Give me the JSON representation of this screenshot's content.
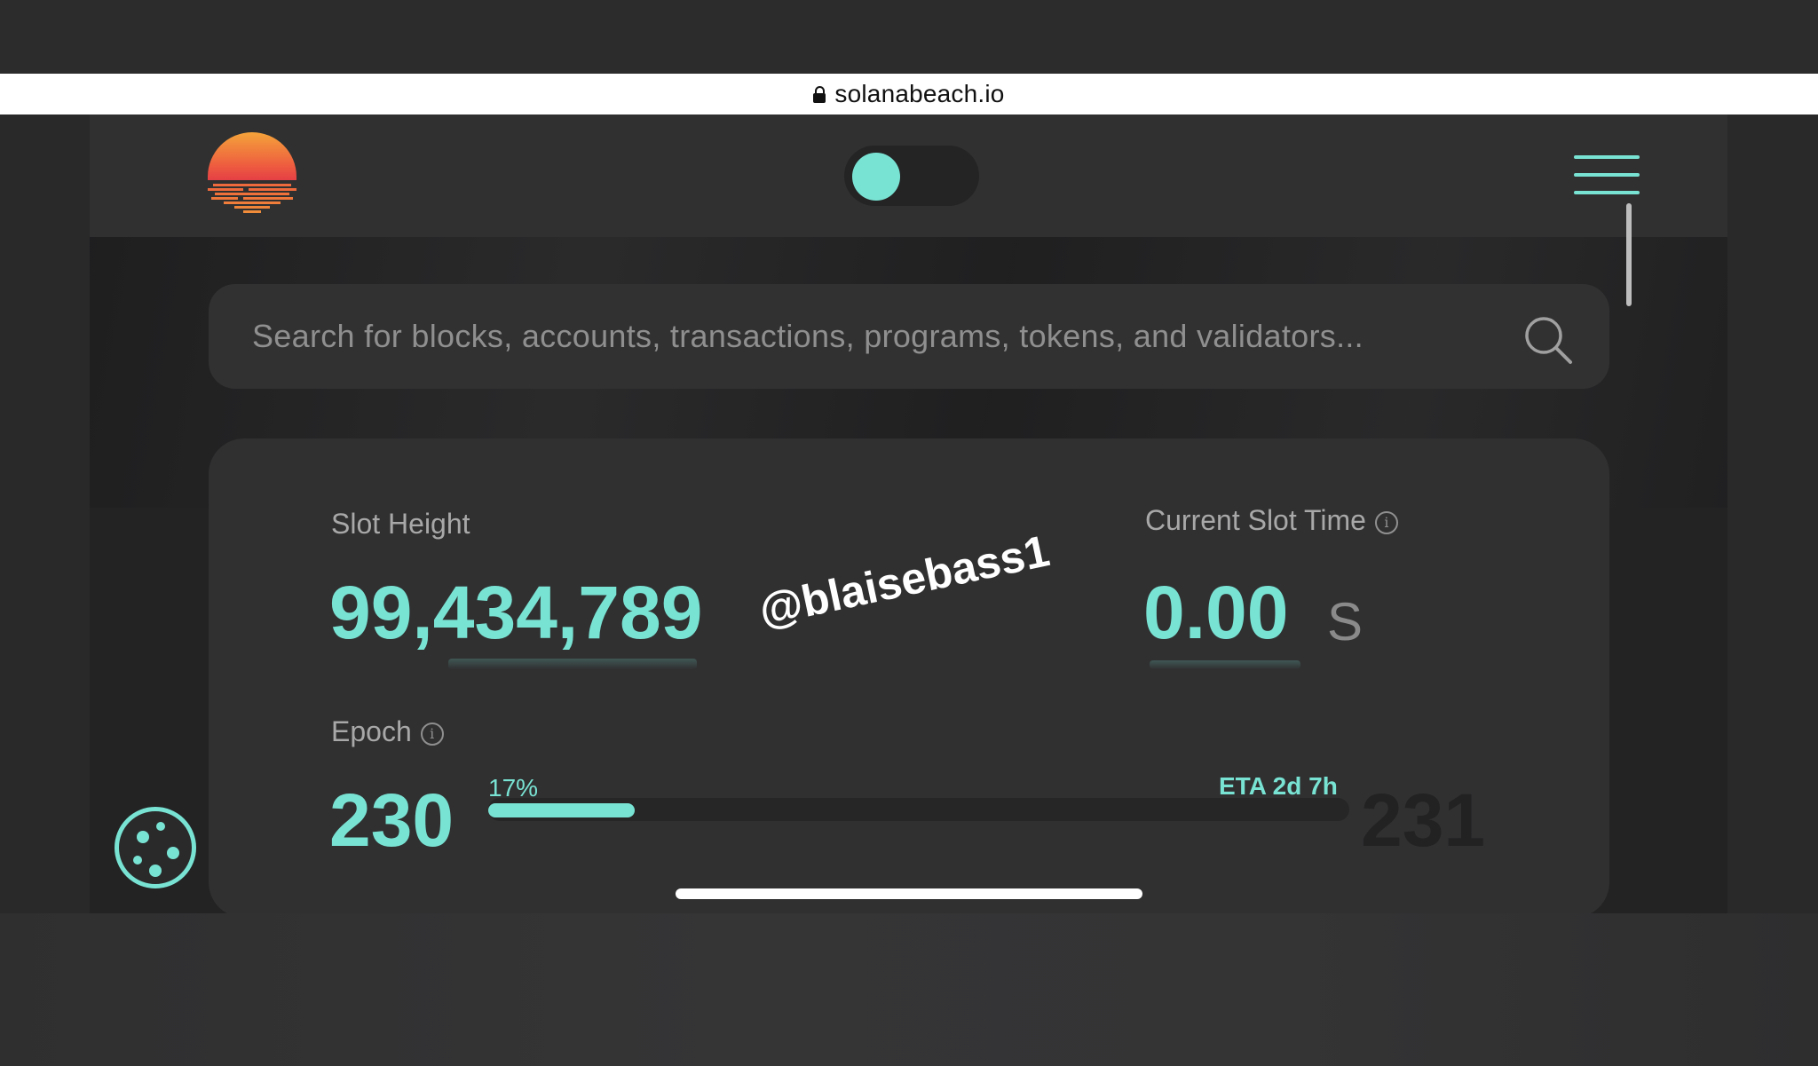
{
  "browser": {
    "url": "solanabeach.io"
  },
  "header": {
    "logo_icon": "sunset-logo-icon",
    "theme_toggle": {
      "state": "on",
      "accent": "#79e3d3"
    },
    "menu_icon": "hamburger-menu-icon"
  },
  "search": {
    "placeholder": "Search for blocks, accounts, transactions, programs, tokens, and validators...",
    "icon": "search-icon"
  },
  "stats": {
    "slot_height": {
      "label": "Slot Height",
      "value": "99,434,789"
    },
    "current_slot_time": {
      "label": "Current Slot Time",
      "value": "0.00",
      "unit": "S"
    },
    "epoch": {
      "label": "Epoch",
      "current": "230",
      "next": "231",
      "progress_label": "17%",
      "progress": 0.17,
      "eta": "ETA 2d 7h"
    }
  },
  "watermark": "@blaisebass1",
  "cookie_icon": "cookie-icon",
  "colors": {
    "accent": "#79e3d3",
    "background": "#232324",
    "card": "#303031"
  }
}
